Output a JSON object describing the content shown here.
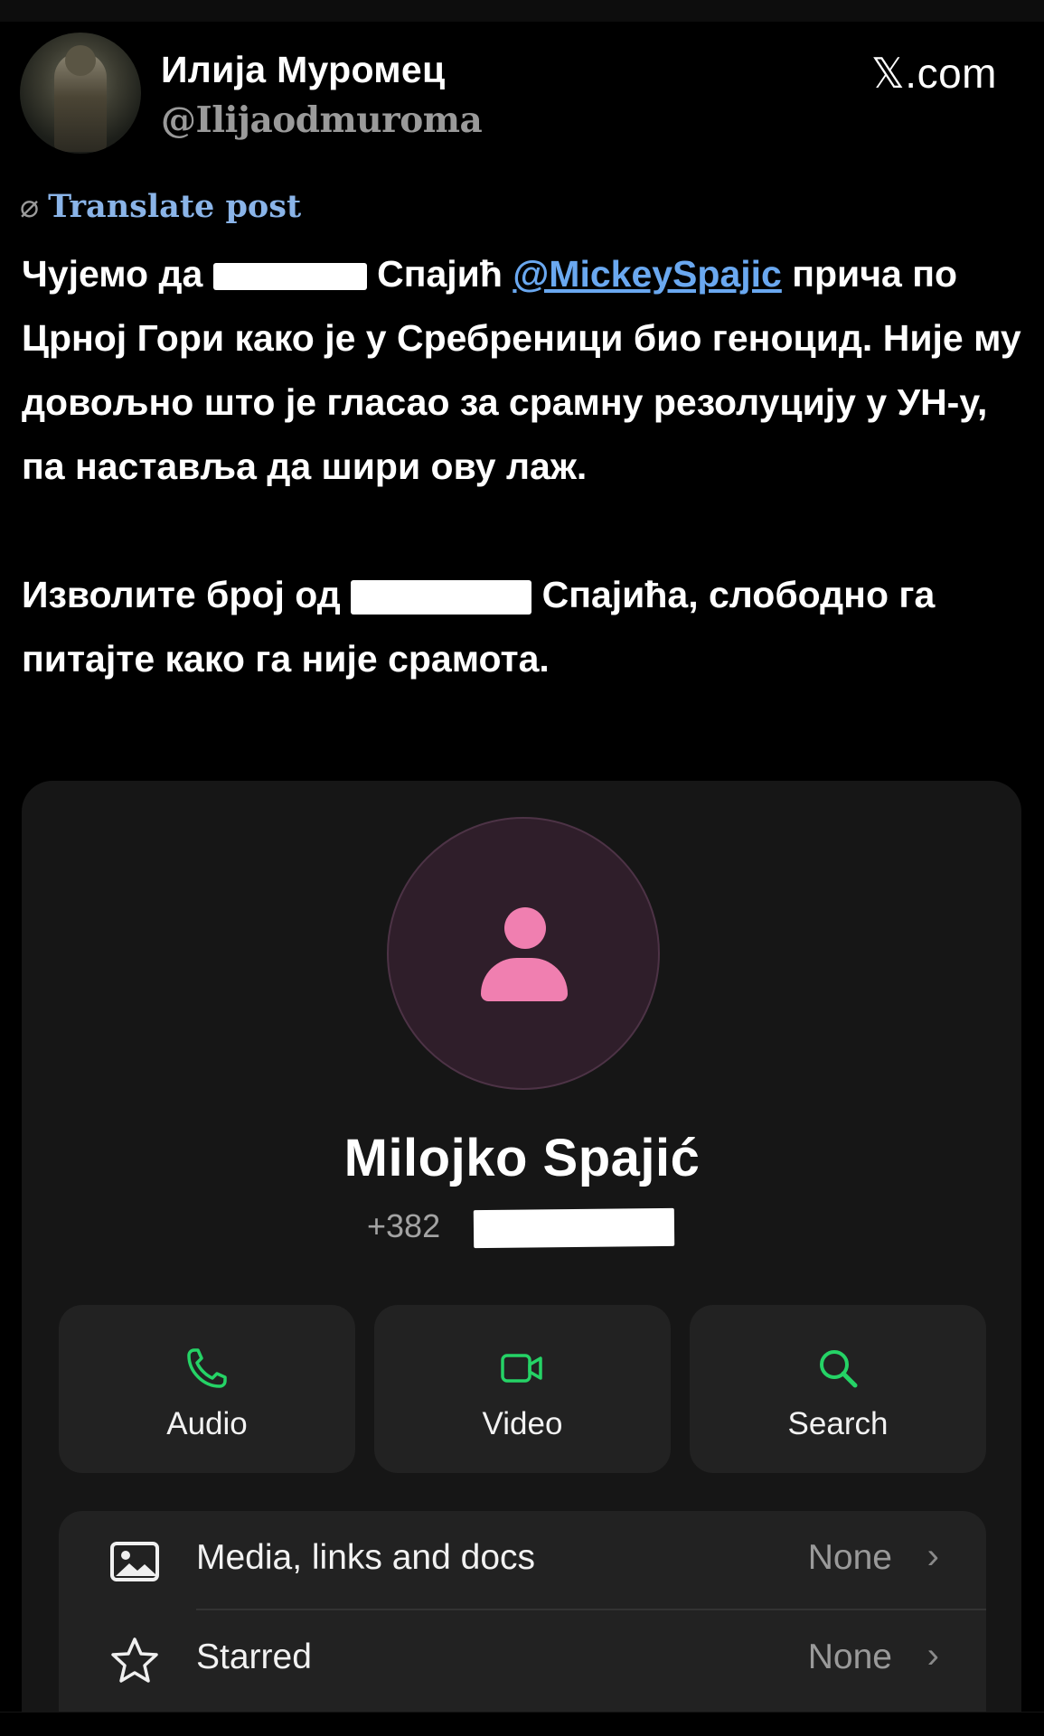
{
  "post": {
    "author_name": "Илија Муромец",
    "author_handle": "@Ilijaodmuroma",
    "site": "𝕏.com",
    "translate_label": "Translate post",
    "p1_part1": "Чујемо да ",
    "p1_part2": " Спајић ",
    "mention": "@MickeySpajic",
    "p1_part3": " прича по Црној Гори како је у Сребреници био геноцид. Није му довољно што је гласао за срамну резолуцију у УН-у, па наставља да шири ову лаж.",
    "p2_part1": "Изволите број од ",
    "p2_part2": " Спајића, слободно га питајте како га није срамота."
  },
  "contact": {
    "name": "Milojko Spajić",
    "phone_prefix": "+382",
    "actions": [
      {
        "label": "Audio",
        "icon": "phone-icon"
      },
      {
        "label": "Video",
        "icon": "video-camera-icon"
      },
      {
        "label": "Search",
        "icon": "search-icon"
      }
    ],
    "rows": [
      {
        "label": "Media, links and docs",
        "value": "None",
        "icon": "image-icon"
      },
      {
        "label": "Starred",
        "value": "None",
        "icon": "star-icon"
      }
    ],
    "accent_green": "#25d366",
    "avatar_pink": "#f07fb0"
  }
}
